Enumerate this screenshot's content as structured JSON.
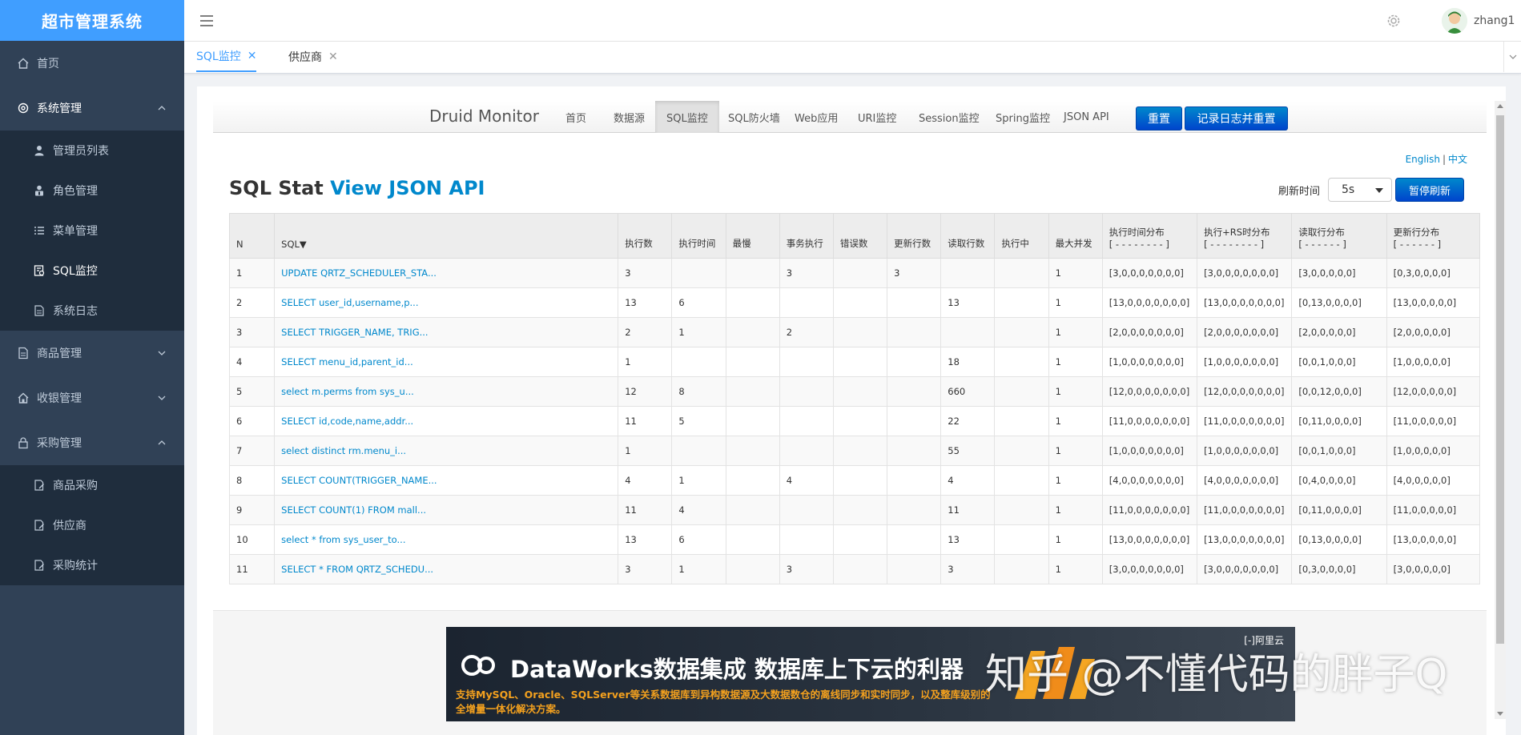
{
  "app": {
    "title": "超市管理系统"
  },
  "sidebar": {
    "items": [
      {
        "label": "首页",
        "icon": "home-icon"
      },
      {
        "label": "系统管理",
        "icon": "gear-icon",
        "expanded": true,
        "children": [
          {
            "label": "管理员列表",
            "icon": "user-icon"
          },
          {
            "label": "角色管理",
            "icon": "role-icon"
          },
          {
            "label": "菜单管理",
            "icon": "list-icon"
          },
          {
            "label": "SQL监控",
            "icon": "monitor-icon",
            "active": true
          },
          {
            "label": "系统日志",
            "icon": "log-icon"
          }
        ]
      },
      {
        "label": "商品管理",
        "icon": "document-icon",
        "expanded": false
      },
      {
        "label": "收银管理",
        "icon": "home-icon",
        "expanded": false
      },
      {
        "label": "采购管理",
        "icon": "lock-icon",
        "expanded": true,
        "children": [
          {
            "label": "商品采购",
            "icon": "doc-edit-icon"
          },
          {
            "label": "供应商",
            "icon": "doc-edit-icon"
          },
          {
            "label": "采购统计",
            "icon": "doc-edit-icon"
          }
        ]
      }
    ]
  },
  "header": {
    "username": "zhang1"
  },
  "tabs": [
    {
      "label": "SQL监控",
      "active": true
    },
    {
      "label": "供应商",
      "active": false
    }
  ],
  "druid": {
    "brand": "Druid Monitor",
    "nav": [
      "首页",
      "数据源",
      "SQL监控",
      "SQL防火墙",
      "Web应用",
      "URI监控",
      "Session监控",
      "Spring监控",
      "JSON API"
    ],
    "active_nav": "SQL监控",
    "reset_label": "重置",
    "log_reset_label": "记录日志并重置",
    "lang_en": "English",
    "lang_sep": "|",
    "lang_cn": "中文",
    "title_prefix": "SQL Stat",
    "title_link": "View JSON API",
    "refresh_label": "刷新时间",
    "refresh_value": "5s",
    "pause_label": "暂停刷新"
  },
  "table": {
    "headers": [
      "N",
      "SQL▼",
      "执行数",
      "执行时间",
      "最慢",
      "事务执行",
      "错误数",
      "更新行数",
      "读取行数",
      "执行中",
      "最大并发",
      "执行时间分布",
      "执行+RS时分布",
      "读取行分布",
      "更新行分布"
    ],
    "dist_hints": {
      "执行时间分布": "[ - - - - - - - - ]",
      "执行+RS时分布": "[ - - - - - - - - ]",
      "读取行分布": "[ - - - - - - ]",
      "更新行分布": "[ - - - - - - ]"
    },
    "rows": [
      [
        "1",
        "UPDATE QRTZ_SCHEDULER_STA...",
        "3",
        "",
        "",
        "3",
        "",
        "3",
        "",
        "",
        "1",
        "[3,0,0,0,0,0,0,0]",
        "[3,0,0,0,0,0,0,0]",
        "[3,0,0,0,0,0]",
        "[0,3,0,0,0,0]"
      ],
      [
        "2",
        "SELECT user_id,username,p...",
        "13",
        "6",
        "",
        "",
        "",
        "",
        "13",
        "",
        "1",
        "[13,0,0,0,0,0,0,0]",
        "[13,0,0,0,0,0,0,0]",
        "[0,13,0,0,0,0]",
        "[13,0,0,0,0,0]"
      ],
      [
        "3",
        "SELECT TRIGGER_NAME, TRIG...",
        "2",
        "1",
        "",
        "2",
        "",
        "",
        "",
        "",
        "1",
        "[2,0,0,0,0,0,0,0]",
        "[2,0,0,0,0,0,0,0]",
        "[2,0,0,0,0,0]",
        "[2,0,0,0,0,0]"
      ],
      [
        "4",
        "SELECT menu_id,parent_id...",
        "1",
        "",
        "",
        "",
        "",
        "",
        "18",
        "",
        "1",
        "[1,0,0,0,0,0,0,0]",
        "[1,0,0,0,0,0,0,0]",
        "[0,0,1,0,0,0]",
        "[1,0,0,0,0,0]"
      ],
      [
        "5",
        "select m.perms from sys_u...",
        "12",
        "8",
        "",
        "",
        "",
        "",
        "660",
        "",
        "1",
        "[12,0,0,0,0,0,0,0]",
        "[12,0,0,0,0,0,0,0]",
        "[0,0,12,0,0,0]",
        "[12,0,0,0,0,0]"
      ],
      [
        "6",
        "SELECT id,code,name,addr...",
        "11",
        "5",
        "",
        "",
        "",
        "",
        "22",
        "",
        "1",
        "[11,0,0,0,0,0,0,0]",
        "[11,0,0,0,0,0,0,0]",
        "[0,11,0,0,0,0]",
        "[11,0,0,0,0,0]"
      ],
      [
        "7",
        "select distinct rm.menu_i...",
        "1",
        "",
        "",
        "",
        "",
        "",
        "55",
        "",
        "1",
        "[1,0,0,0,0,0,0,0]",
        "[1,0,0,0,0,0,0,0]",
        "[0,0,1,0,0,0]",
        "[1,0,0,0,0,0]"
      ],
      [
        "8",
        "SELECT COUNT(TRIGGER_NAME...",
        "4",
        "1",
        "",
        "4",
        "",
        "",
        "4",
        "",
        "1",
        "[4,0,0,0,0,0,0,0]",
        "[4,0,0,0,0,0,0,0]",
        "[0,4,0,0,0,0]",
        "[4,0,0,0,0,0]"
      ],
      [
        "9",
        "SELECT COUNT(1) FROM mall...",
        "11",
        "4",
        "",
        "",
        "",
        "",
        "11",
        "",
        "1",
        "[11,0,0,0,0,0,0,0]",
        "[11,0,0,0,0,0,0,0]",
        "[0,11,0,0,0,0]",
        "[11,0,0,0,0,0]"
      ],
      [
        "10",
        "select * from sys_user_to...",
        "13",
        "6",
        "",
        "",
        "",
        "",
        "13",
        "",
        "1",
        "[13,0,0,0,0,0,0,0]",
        "[13,0,0,0,0,0,0,0]",
        "[0,13,0,0,0,0]",
        "[13,0,0,0,0,0]"
      ],
      [
        "11",
        "SELECT * FROM QRTZ_SCHEDU...",
        "3",
        "1",
        "",
        "3",
        "",
        "",
        "3",
        "",
        "1",
        "[3,0,0,0,0,0,0,0]",
        "[3,0,0,0,0,0,0,0]",
        "[0,3,0,0,0,0]",
        "[3,0,0,0,0,0]"
      ]
    ]
  },
  "banner": {
    "title": "DataWorks数据集成 数据库上下云的利器",
    "subtitle": "支持MySQL、Oracle、SQLServer等关系数据库到异构数据源及大数据数仓的离线同步和实时同步，以及整库级别的全增量一体化解决方案。",
    "brand": "[-]阿里云"
  },
  "watermark": "知乎 @不懂代码的胖子Q",
  "colors": {
    "accent": "#409eff",
    "sidebar_bg": "#304156",
    "link": "#0088cc"
  }
}
